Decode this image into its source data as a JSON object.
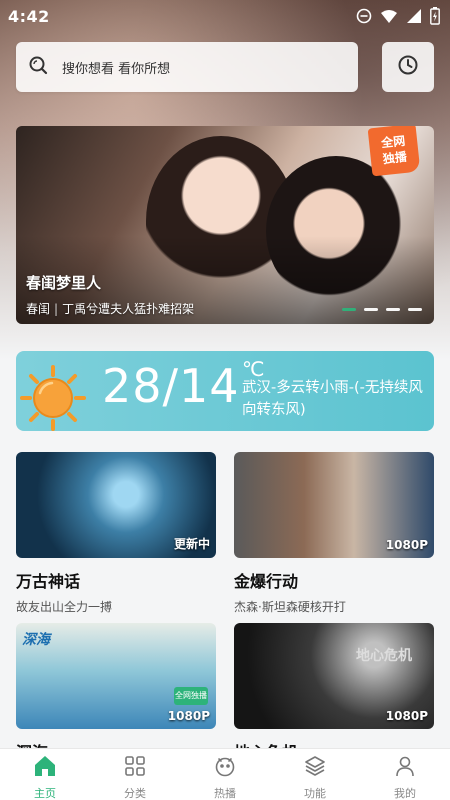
{
  "status_bar": {
    "time": "4:42"
  },
  "search": {
    "placeholder": "搜你想看 看你所想"
  },
  "banner": {
    "badge_line1": "全网",
    "badge_line2": "独播",
    "title": "春闺梦里人",
    "subtitle_tag": "春闺",
    "subtitle_sep": "|",
    "subtitle_text": "丁禹兮遭夫人猛扑难招架",
    "dots": 4,
    "active_dot": 0
  },
  "weather": {
    "temp": "28/14",
    "unit": "℃",
    "description": "武汉-多云转小雨-(-无持续风向转东风)"
  },
  "cards": [
    {
      "title": "万古神话",
      "desc": "故友出山全力一搏",
      "tag": "更新中"
    },
    {
      "title": "金爆行动",
      "desc": "杰森·斯坦森硬核开打",
      "tag": "1080P"
    },
    {
      "title": "深海",
      "desc": "",
      "tag": "1080P",
      "logo_text": "深海",
      "mini_badge": "全网独播"
    },
    {
      "title": "地心危机",
      "desc": "",
      "tag": "1080P",
      "poster_text": "地心危机"
    }
  ],
  "nav": [
    {
      "label": "主页",
      "icon": "home-icon",
      "active": true
    },
    {
      "label": "分类",
      "icon": "grid-icon",
      "active": false
    },
    {
      "label": "热播",
      "icon": "face-icon",
      "active": false
    },
    {
      "label": "功能",
      "icon": "layers-icon",
      "active": false
    },
    {
      "label": "我的",
      "icon": "user-icon",
      "active": false
    }
  ],
  "colors": {
    "accent": "#2db37a",
    "weather_bg": "#6ccad6",
    "badge": "#f26a2e"
  }
}
